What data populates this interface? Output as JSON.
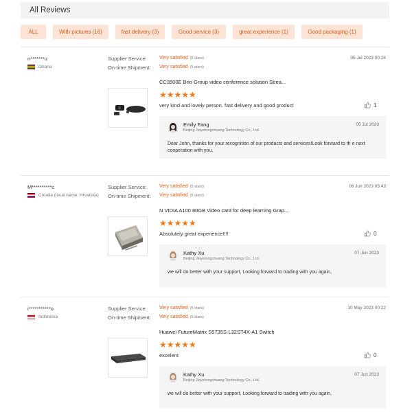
{
  "header": {
    "title": "All Reviews"
  },
  "filters": [
    {
      "label": "ALL"
    },
    {
      "label": "With pictures (16)"
    },
    {
      "label": "fast delivery (3)"
    },
    {
      "label": "Good service (3)"
    },
    {
      "label": "great experience (1)"
    },
    {
      "label": "Good packaging (1)"
    }
  ],
  "labels": {
    "supplier_service": "Supplier Service:",
    "ontime_shipment": "On-time Shipment:"
  },
  "reviews": [
    {
      "user": "n*******u",
      "country": "Ghana",
      "flag": "flag-gh",
      "date": "05 Jul 2023 00:24",
      "supplier_rating": "Very satisfied",
      "supplier_stars": "(5 stars)",
      "shipment_rating": "Very satisfied",
      "shipment_stars": "(5 stars)",
      "product_icon": "video-conference-camera-icon",
      "product": "CC3500E Brio Group video conference solution Strea...",
      "rating": 5,
      "comment": "very kind and lovely person. fast delivery and good product",
      "likes": "1",
      "reply": {
        "name": "Emily Fang",
        "company": "Beijing Jiayetongchuang Technology Co., Ltd.",
        "date": "05 Jul 2023",
        "text": "Dear John, thanks for your recognition of our products and services!Look forward to th e next cooperation with you."
      }
    },
    {
      "user": "M**********c",
      "country": "Croatia (local name: Hrvatska)",
      "flag": "flag-hr",
      "date": "06 Jun 2023 05:43",
      "supplier_rating": "Very satisfied",
      "supplier_stars": "(5 stars)",
      "shipment_rating": "Very satisfied",
      "shipment_stars": "(5 stars)",
      "product_icon": "graphics-card-icon",
      "product": "N VIDIA A100 80GB Video card for deep learning Grap...",
      "rating": 5,
      "comment": "Absolutely great experience!!!!",
      "likes": "0",
      "reply": {
        "name": "Kathy Xu",
        "company": "Beijing Jiayetongchuang Technology Co., Ltd.",
        "date": "07 Jun 2023",
        "text": "we will do better with your support, Looking forward to trading with you again,"
      }
    },
    {
      "user": "i***********o",
      "country": "Indonesia",
      "flag": "flag-id",
      "date": "10 May 2023 00:22",
      "supplier_rating": "Very satisfied",
      "supplier_stars": "(5 stars)",
      "shipment_rating": "Very satisfied",
      "shipment_stars": "(5 stars)",
      "product_icon": "network-switch-icon",
      "product": "Huawei FutureMatrix S5735S-L32ST4X-A1 Switch",
      "rating": 5,
      "comment": "excelent",
      "likes": "0",
      "reply": {
        "name": "Kathy Xu",
        "company": "Beijing Jiayetongchuang Technology Co., Ltd.",
        "date": "07 Jun 2023",
        "text": "we will do better with your support, Looking forward to trading with you again,"
      }
    }
  ]
}
